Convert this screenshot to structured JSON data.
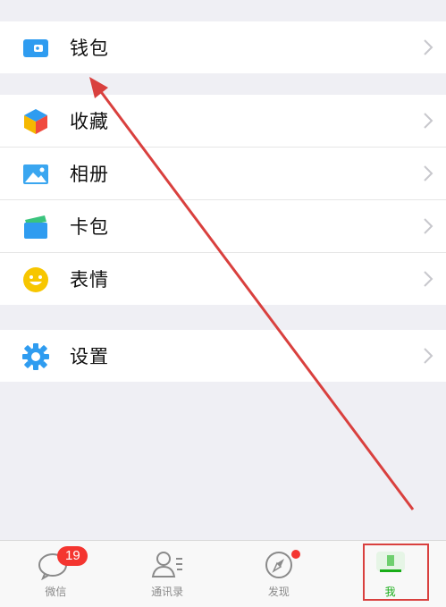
{
  "menu": {
    "wallet_label": "钱包",
    "favorites_label": "收藏",
    "album_label": "相册",
    "card_wallet_label": "卡包",
    "stickers_label": "表情",
    "settings_label": "设置"
  },
  "tabbar": {
    "chats_label": "微信",
    "chats_badge": "19",
    "contacts_label": "通讯录",
    "discover_label": "发现",
    "me_label": "我"
  },
  "colors": {
    "accent_green": "#1aad19",
    "badge_red": "#f43530",
    "annotation_red": "#d9403e"
  }
}
